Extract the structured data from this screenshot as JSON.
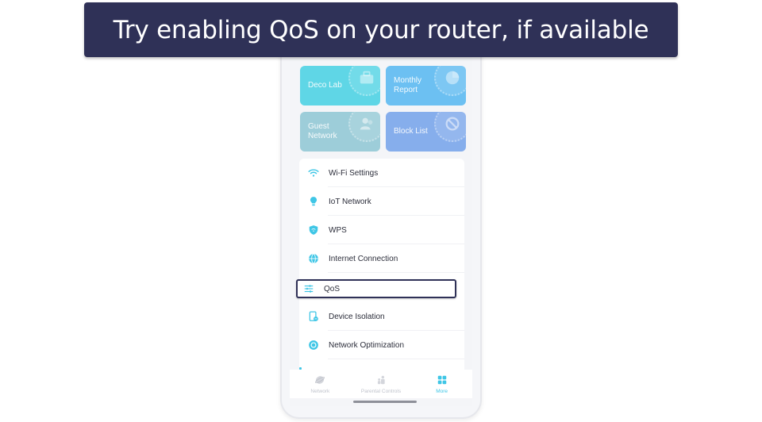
{
  "banner": {
    "text": "Try enabling QoS on your router, if available"
  },
  "tiles": [
    {
      "label": "Deco Lab",
      "icon": "toolbox-icon",
      "color": "#5fd6e6"
    },
    {
      "label": "Monthly\nReport",
      "icon": "pie-chart-icon",
      "color": "#6cc0f2"
    },
    {
      "label": "Guest\nNetwork",
      "icon": "users-icon",
      "color": "#9dcdd9"
    },
    {
      "label": "Block List",
      "icon": "block-icon",
      "color": "#86aeec"
    }
  ],
  "menu": {
    "items": [
      {
        "label": "Wi-Fi Settings",
        "icon": "wifi-icon"
      },
      {
        "label": "IoT Network",
        "icon": "bulb-icon"
      },
      {
        "label": "WPS",
        "icon": "shield-wifi-icon"
      },
      {
        "label": "Internet Connection",
        "icon": "globe-icon"
      },
      {
        "label": "QoS",
        "icon": "sliders-icon",
        "highlighted": true
      },
      {
        "label": "Device Isolation",
        "icon": "device-block-icon"
      },
      {
        "label": "Network Optimization",
        "icon": "optimize-icon"
      }
    ]
  },
  "tabbar": {
    "tabs": [
      {
        "label": "Network",
        "icon": "planet-icon",
        "active": false
      },
      {
        "label": "Parental Controls",
        "icon": "family-icon",
        "active": false
      },
      {
        "label": "More",
        "icon": "grid-icon",
        "active": true
      }
    ]
  },
  "colors": {
    "accent": "#3fc6e6",
    "banner_bg": "#2f3157",
    "highlight_border": "#2f3157"
  }
}
